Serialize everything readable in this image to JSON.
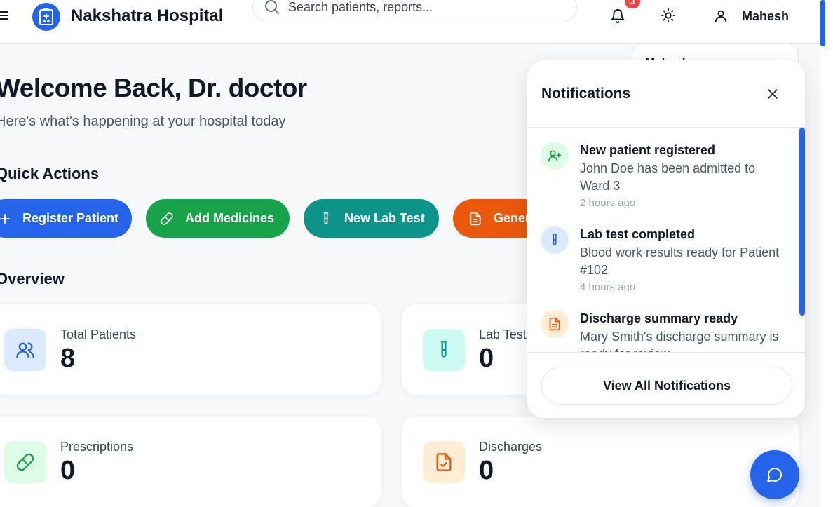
{
  "header": {
    "brand": "Nakshatra Hospital",
    "search_placeholder": "Search patients, reports...",
    "notification_count": "3",
    "user_name": "Mahesh"
  },
  "main": {
    "welcome": "Welcome Back, Dr. doctor",
    "subtitle": "Here's what's happening at your hospital today",
    "quick_actions_title": "Quick Actions",
    "quick_actions": [
      {
        "label": "Register Patient",
        "icon": "plus-icon",
        "color": "#2563eb"
      },
      {
        "label": "Add Medicines",
        "icon": "pill-icon",
        "color": "#16a34a"
      },
      {
        "label": "New Lab Test",
        "icon": "test-tube-icon",
        "color": "#0d9488"
      },
      {
        "label": "Generate",
        "icon": "document-icon",
        "color": "#ea580c"
      }
    ],
    "overview_title": "Overview",
    "stats": [
      {
        "label": "Total Patients",
        "value": "8",
        "icon": "users-icon"
      },
      {
        "label": "Lab Tests",
        "value": "0",
        "icon": "test-tube-icon"
      },
      {
        "label": "Prescriptions",
        "value": "0",
        "icon": "pill-icon"
      },
      {
        "label": "Discharges",
        "value": "0",
        "icon": "file-check-icon"
      }
    ]
  },
  "notifications": {
    "title": "Notifications",
    "items": [
      {
        "title": "New patient registered",
        "body": "John Doe has been admitted to Ward 3",
        "time": "2 hours ago",
        "icon": "user-plus-icon",
        "color": "#16a34a"
      },
      {
        "title": "Lab test completed",
        "body": "Blood work results ready for Patient #102",
        "time": "4 hours ago",
        "icon": "test-tube-icon",
        "color": "#2563eb"
      },
      {
        "title": "Discharge summary ready",
        "body": "Mary Smith's discharge summary is ready for review",
        "time": "",
        "icon": "document-icon",
        "color": "#ea580c"
      }
    ],
    "view_all": "View All Notifications"
  },
  "behind_panel_text": "Mahesh"
}
